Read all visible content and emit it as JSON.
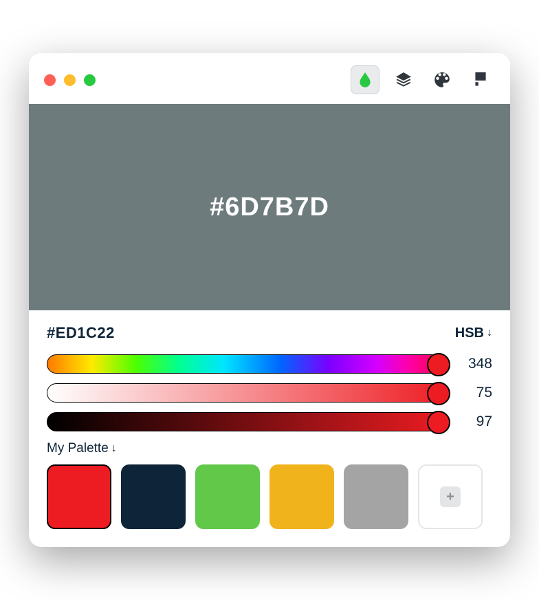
{
  "preview": {
    "hex": "#6D7B7D",
    "bg": "#6D7B7D"
  },
  "current": {
    "hex": "#ED1C22"
  },
  "mode": {
    "label": "HSB"
  },
  "sliders": {
    "hue": 348,
    "sat": 75,
    "bri": 97,
    "sat_grad": [
      "#FFFFFF",
      "#ED1C22"
    ],
    "bri_grad": [
      "#000000",
      "#ED1C22"
    ]
  },
  "palette": {
    "title": "My Palette",
    "swatches": [
      {
        "color": "#ED1C22",
        "selected": true
      },
      {
        "color": "#0E2438",
        "selected": false
      },
      {
        "color": "#62C84A",
        "selected": false
      },
      {
        "color": "#F1B31C",
        "selected": false
      },
      {
        "color": "#A4A4A4",
        "selected": false
      }
    ],
    "add_label": "+"
  },
  "toolbar": {
    "tools": [
      "drop",
      "layers",
      "palette",
      "brush"
    ],
    "active": "drop"
  }
}
